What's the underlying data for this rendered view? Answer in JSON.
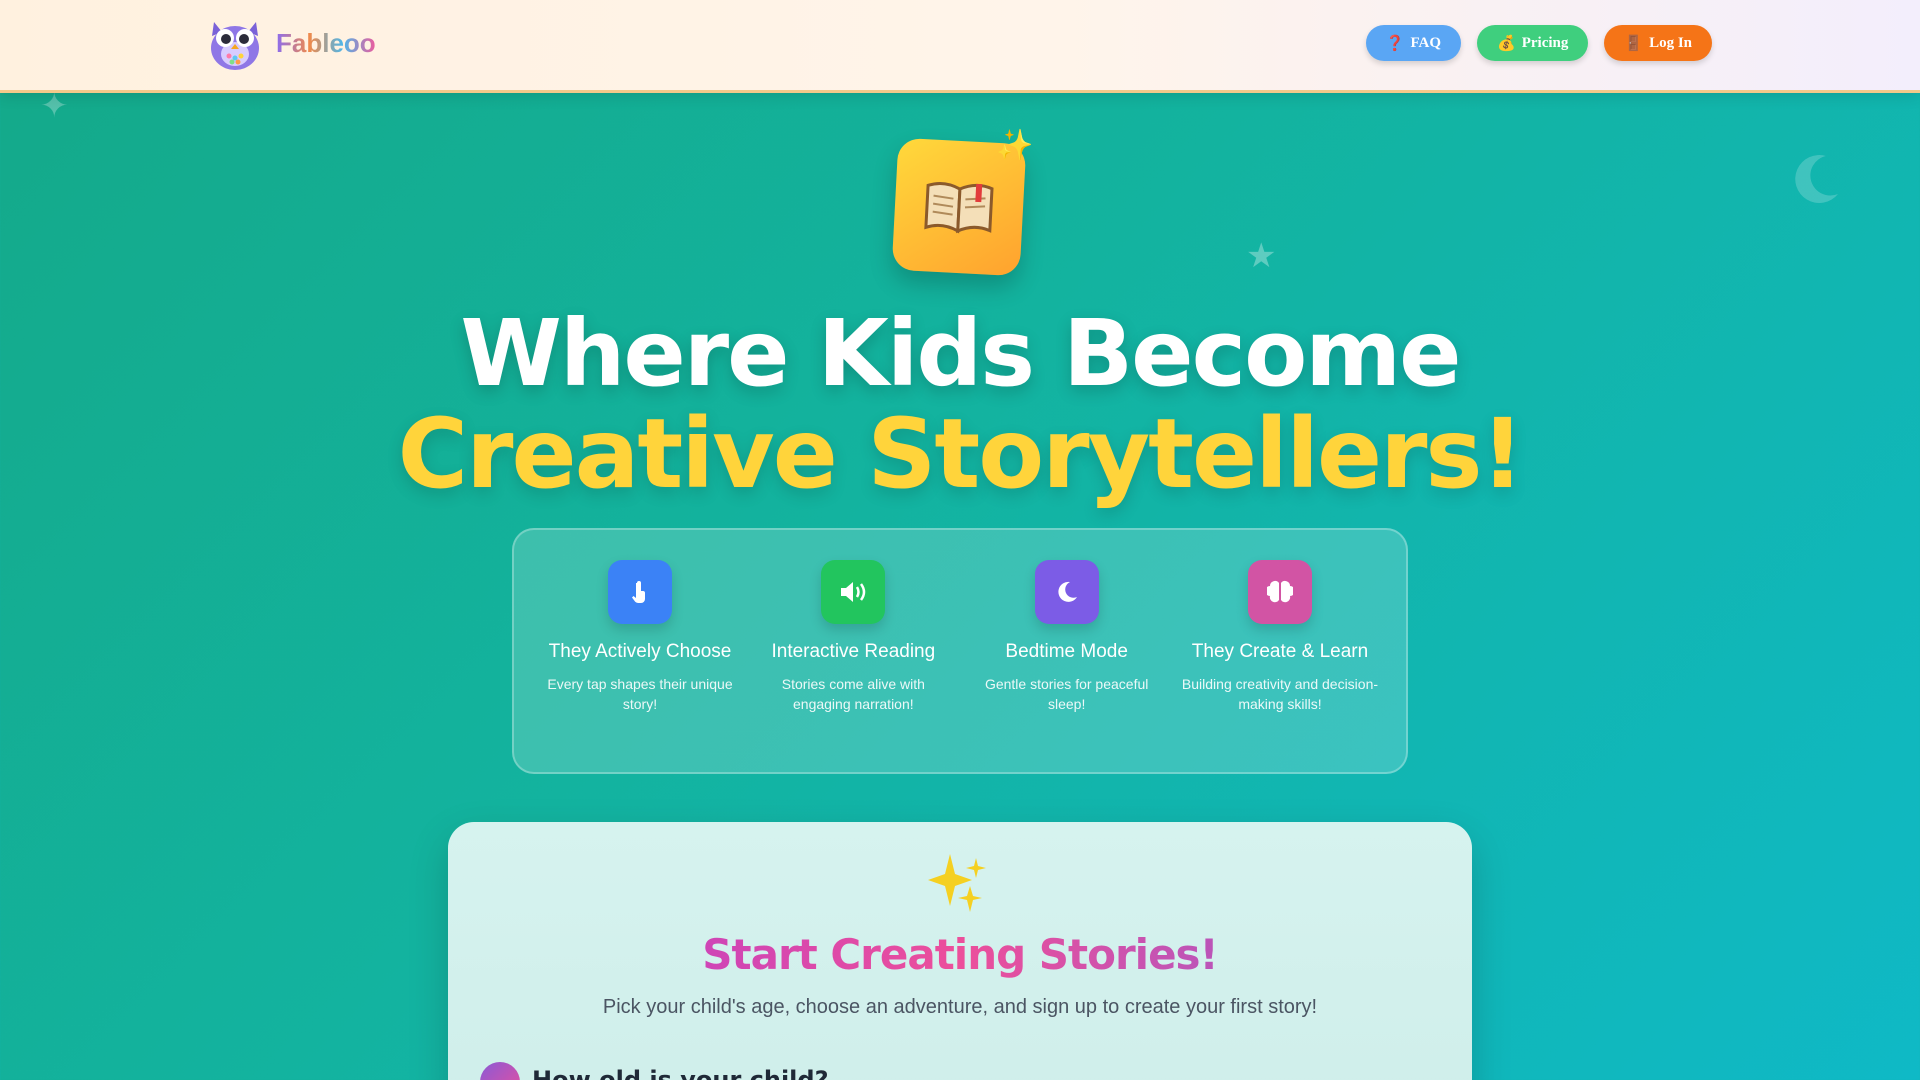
{
  "header": {
    "brand": "Fableoo",
    "nav": [
      {
        "emoji": "❓",
        "label": "FAQ"
      },
      {
        "emoji": "💰",
        "label": "Pricing"
      },
      {
        "emoji": "🚪",
        "label": "Log In"
      }
    ]
  },
  "hero": {
    "line1": "Where Kids Become",
    "line2": "Creative Storytellers!"
  },
  "features": [
    {
      "icon": "tap-hand-icon",
      "color": "#3b82f6",
      "title": "They Actively Choose",
      "desc": "Every tap shapes their unique story!"
    },
    {
      "icon": "speaker-icon",
      "color": "#22c55e",
      "title": "Interactive Reading",
      "desc": "Stories come alive with engaging narration!"
    },
    {
      "icon": "moon-icon",
      "color": "#7c5ce6",
      "title": "Bedtime Mode",
      "desc": "Gentle stories for peaceful sleep!"
    },
    {
      "icon": "brain-icon",
      "color": "#d254a4",
      "title": "They Create & Learn",
      "desc": "Building creativity and decision-making skills!"
    }
  ],
  "create": {
    "title": "Start Creating Stories!",
    "subtitle": "Pick your child's age, choose an adventure, and sign up to create your first story!",
    "step_question": "How old is your child?"
  }
}
